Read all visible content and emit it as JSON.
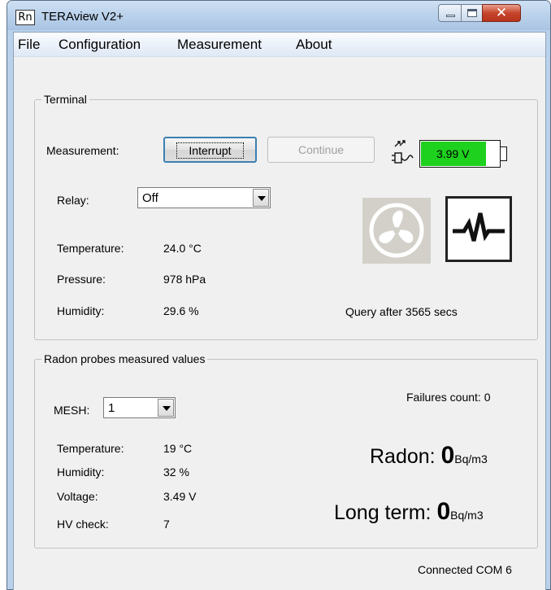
{
  "window": {
    "icon_text": "Rn",
    "title": "TERAview V2+"
  },
  "menu": [
    "File",
    "Configuration",
    "Measurement",
    "About"
  ],
  "terminal": {
    "group_label": "Terminal",
    "measurement_label": "Measurement:",
    "interrupt_button": "Interrupt",
    "continue_button": "Continue",
    "battery_voltage": "3.99 V",
    "battery_level": 0.82,
    "relay_label": "Relay:",
    "relay_value": "Off",
    "temperature_label": "Temperature:",
    "temperature_value": "24.0 °C",
    "pressure_label": "Pressure:",
    "pressure_value": "978 hPa",
    "humidity_label": "Humidity:",
    "humidity_value": "29.6 %",
    "query_text": "Query after 3565 secs"
  },
  "probes": {
    "group_label": "Radon probes measured values",
    "mesh_label": "MESH:",
    "mesh_value": "1",
    "failures_text": "Failures count: 0",
    "temperature_label": "Temperature:",
    "temperature_value": "19 °C",
    "humidity_label": "Humidity:",
    "humidity_value": "32 %",
    "voltage_label": "Voltage:",
    "voltage_value": "3.49 V",
    "hv_label": "HV check:",
    "hv_value": "7",
    "radon_label": "Radon:",
    "radon_value": "0",
    "radon_unit": "Bq/m3",
    "longterm_label": "Long term:",
    "longterm_value": "0",
    "longterm_unit": "Bq/m3"
  },
  "status": {
    "connection": "Connected COM 6"
  },
  "icons": {
    "charging": "charging-plug-icon",
    "fan": "fan-icon",
    "pulse": "heartbeat-pulse-icon"
  },
  "colors": {
    "battery_fill": "#1ed11e",
    "fan_tile": "#d3d0c9"
  }
}
